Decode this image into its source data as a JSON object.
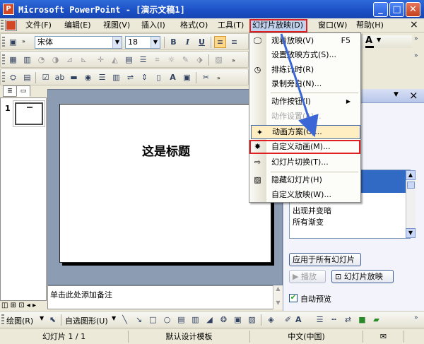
{
  "window": {
    "app_icon": "P",
    "title": "Microsoft PowerPoint - [演示文稿1]",
    "min_label": "_",
    "max_label": "□",
    "close_label": "✕"
  },
  "menubar": {
    "items": [
      "文件(F)",
      "编辑(E)",
      "视图(V)",
      "插入(I)",
      "格式(O)",
      "工具(T)",
      "幻灯片放映(D)",
      "窗口(W)",
      "帮助(H)"
    ],
    "close_label": "×"
  },
  "format_toolbar": {
    "font": "宋体",
    "size": "18",
    "bold": "B",
    "italic": "I",
    "underline": "U",
    "text_color_label": "A"
  },
  "slide": {
    "title": "这是标题",
    "number": "1"
  },
  "notes": {
    "placeholder": "单击此处添加备注"
  },
  "taskpane": {
    "effects": [
      "出现",
      "出现并变暗",
      "所有渐变"
    ],
    "apply_all": "应用于所有幻灯片",
    "play": "播放",
    "slideshow": "幻灯片放映",
    "autopreview": "自动预览",
    "close_label": "×",
    "menu_arrow": "▼"
  },
  "dropdown": {
    "items": [
      {
        "label": "观看放映(V)",
        "shortcut": "F5"
      },
      {
        "label": "设置放映方式(S)..."
      },
      {
        "label": "排练计时(R)"
      },
      {
        "label": "录制旁白(N)..."
      },
      {
        "label": "动作按钮(I)"
      },
      {
        "label": "动作设置(A)..."
      },
      {
        "label": "动画方案(C)..."
      },
      {
        "label": "自定义动画(M)..."
      },
      {
        "label": "幻灯片切换(T)..."
      },
      {
        "label": "隐藏幻灯片(H)"
      },
      {
        "label": "自定义放映(W)..."
      }
    ],
    "submenu_arrow": "▶"
  },
  "drawbar": {
    "draw": "绘图(R)",
    "autoshapes": "自选图形(U)"
  },
  "status": {
    "slide": "幻灯片 1 / 1",
    "template": "默认设计模板",
    "language": "中文(中国)"
  },
  "colors": {
    "highlight_box": "#e02020",
    "arrow": "#3a66d6",
    "titlebar": "#1b4fc4"
  }
}
